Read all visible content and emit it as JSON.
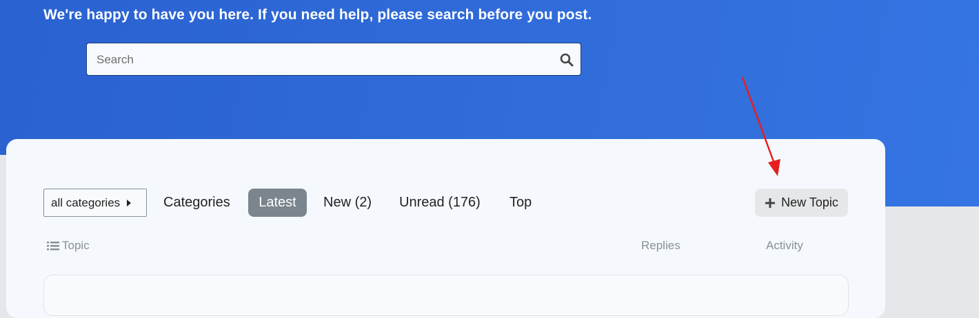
{
  "hero": {
    "welcome_text": "We're happy to have you here. If you need help, please search before you post."
  },
  "search": {
    "placeholder": "Search",
    "value": "",
    "icon": "search-icon"
  },
  "filters": {
    "category_dropdown": "all categories",
    "nav": [
      {
        "label": "Categories",
        "active": false
      },
      {
        "label": "Latest",
        "active": true
      },
      {
        "label": "New (2)",
        "active": false
      },
      {
        "label": "Unread (176)",
        "active": false
      },
      {
        "label": "Top",
        "active": false
      }
    ],
    "new_topic_label": "New Topic"
  },
  "table": {
    "columns": {
      "topic": "Topic",
      "replies": "Replies",
      "activity": "Activity"
    },
    "first_row_title_peek": ""
  },
  "colors": {
    "hero_blue": "#2f6ad8",
    "nav_active_bg": "#7b858d",
    "annotation_arrow": "#e61e1e"
  }
}
